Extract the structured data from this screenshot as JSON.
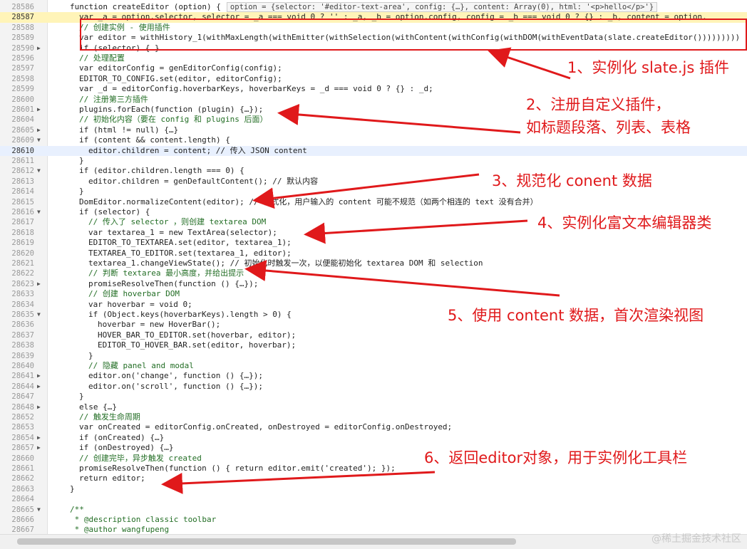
{
  "code_lines": [
    {
      "n": "28586",
      "fold": "",
      "indent": 2,
      "text": "function createEditor (option) {",
      "tip": "option = {selector: '#editor-text-area', config: {…}, content: Array(0), html: '<p>hello</p>'}",
      "cls": ""
    },
    {
      "n": "28587",
      "fold": "",
      "indent": 3,
      "text": "var _a = option.selector, selector = _a === void 0 ? '' : _a, _b = option.config, config = _b === void 0 ? {} : _b, content = option.",
      "tip": "",
      "cls": "hl"
    },
    {
      "n": "28588",
      "fold": "",
      "indent": 3,
      "text": "// 创建实例 - 使用插件",
      "tip": "",
      "cls": "cm"
    },
    {
      "n": "28589",
      "fold": "",
      "indent": 3,
      "text": "var editor = withHistory_1(withMaxLength(withEmitter(withSelection(withContent(withConfig(withDOM(withEventData(slate.createEditor()))))))))",
      "tip": "",
      "cls": ""
    },
    {
      "n": "28590",
      "fold": "▶",
      "indent": 3,
      "text": "if (selector) {…}",
      "tip": "",
      "cls": ""
    },
    {
      "n": "28596",
      "fold": "",
      "indent": 3,
      "text": "// 处理配置",
      "tip": "",
      "cls": "cm"
    },
    {
      "n": "28597",
      "fold": "",
      "indent": 3,
      "text": "var editorConfig = genEditorConfig(config);",
      "tip": "",
      "cls": ""
    },
    {
      "n": "28598",
      "fold": "",
      "indent": 3,
      "text": "EDITOR_TO_CONFIG.set(editor, editorConfig);",
      "tip": "",
      "cls": ""
    },
    {
      "n": "28599",
      "fold": "",
      "indent": 3,
      "text": "var _d = editorConfig.hoverbarKeys, hoverbarKeys = _d === void 0 ? {} : _d;",
      "tip": "",
      "cls": ""
    },
    {
      "n": "28600",
      "fold": "",
      "indent": 3,
      "text": "// 注册第三方插件",
      "tip": "",
      "cls": "cm"
    },
    {
      "n": "28601",
      "fold": "▶",
      "indent": 3,
      "text": "plugins.forEach(function (plugin) {…});",
      "tip": "",
      "cls": ""
    },
    {
      "n": "28604",
      "fold": "",
      "indent": 3,
      "text": "// 初始化内容（要在 config 和 plugins 后面）",
      "tip": "",
      "cls": "cm"
    },
    {
      "n": "28605",
      "fold": "▶",
      "indent": 3,
      "text": "if (html != null) {…}",
      "tip": "",
      "cls": ""
    },
    {
      "n": "28609",
      "fold": "▼",
      "indent": 3,
      "text": "if (content && content.length) {",
      "tip": "",
      "cls": ""
    },
    {
      "n": "28610",
      "fold": "",
      "indent": 4,
      "text": "editor.children = content; // 传入 JSON content",
      "tip": "",
      "cls": "sel"
    },
    {
      "n": "28611",
      "fold": "",
      "indent": 3,
      "text": "}",
      "tip": "",
      "cls": ""
    },
    {
      "n": "28612",
      "fold": "▼",
      "indent": 3,
      "text": "if (editor.children.length === 0) {",
      "tip": "",
      "cls": ""
    },
    {
      "n": "28613",
      "fold": "",
      "indent": 4,
      "text": "editor.children = genDefaultContent(); // 默认内容",
      "tip": "",
      "cls": ""
    },
    {
      "n": "28614",
      "fold": "",
      "indent": 3,
      "text": "}",
      "tip": "",
      "cls": ""
    },
    {
      "n": "28615",
      "fold": "",
      "indent": 3,
      "text": "DomEditor.normalizeContent(editor); // 格式化，用户输入的 content 可能不规范（如两个相连的 text 没有合并）",
      "tip": "",
      "cls": ""
    },
    {
      "n": "28616",
      "fold": "▼",
      "indent": 3,
      "text": "if (selector) {",
      "tip": "",
      "cls": ""
    },
    {
      "n": "28617",
      "fold": "",
      "indent": 4,
      "text": "// 传入了 selector ，则创建 textarea DOM",
      "tip": "",
      "cls": "cm"
    },
    {
      "n": "28618",
      "fold": "",
      "indent": 4,
      "text": "var textarea_1 = new TextArea(selector);",
      "tip": "",
      "cls": ""
    },
    {
      "n": "28619",
      "fold": "",
      "indent": 4,
      "text": "EDITOR_TO_TEXTAREA.set(editor, textarea_1);",
      "tip": "",
      "cls": ""
    },
    {
      "n": "28620",
      "fold": "",
      "indent": 4,
      "text": "TEXTAREA_TO_EDITOR.set(textarea_1, editor);",
      "tip": "",
      "cls": ""
    },
    {
      "n": "28621",
      "fold": "",
      "indent": 4,
      "text": "textarea_1.changeViewState(); // 初始化时触发一次，以便能初始化 textarea DOM 和 selection",
      "tip": "",
      "cls": ""
    },
    {
      "n": "28622",
      "fold": "",
      "indent": 4,
      "text": "// 判断 textarea 最小高度，并给出提示",
      "tip": "",
      "cls": "cm"
    },
    {
      "n": "28623",
      "fold": "▶",
      "indent": 4,
      "text": "promiseResolveThen(function () {…});",
      "tip": "",
      "cls": ""
    },
    {
      "n": "28633",
      "fold": "",
      "indent": 4,
      "text": "// 创建 hoverbar DOM",
      "tip": "",
      "cls": "cm"
    },
    {
      "n": "28634",
      "fold": "",
      "indent": 4,
      "text": "var hoverbar = void 0;",
      "tip": "",
      "cls": ""
    },
    {
      "n": "28635",
      "fold": "▼",
      "indent": 4,
      "text": "if (Object.keys(hoverbarKeys).length > 0) {",
      "tip": "",
      "cls": ""
    },
    {
      "n": "28636",
      "fold": "",
      "indent": 5,
      "text": "hoverbar = new HoverBar();",
      "tip": "",
      "cls": ""
    },
    {
      "n": "28637",
      "fold": "",
      "indent": 5,
      "text": "HOVER_BAR_TO_EDITOR.set(hoverbar, editor);",
      "tip": "",
      "cls": ""
    },
    {
      "n": "28638",
      "fold": "",
      "indent": 5,
      "text": "EDITOR_TO_HOVER_BAR.set(editor, hoverbar);",
      "tip": "",
      "cls": ""
    },
    {
      "n": "28639",
      "fold": "",
      "indent": 4,
      "text": "}",
      "tip": "",
      "cls": ""
    },
    {
      "n": "28640",
      "fold": "",
      "indent": 4,
      "text": "// 隐藏 panel and modal",
      "tip": "",
      "cls": "cm"
    },
    {
      "n": "28641",
      "fold": "▶",
      "indent": 4,
      "text": "editor.on('change', function () {…});",
      "tip": "",
      "cls": ""
    },
    {
      "n": "28644",
      "fold": "▶",
      "indent": 4,
      "text": "editor.on('scroll', function () {…});",
      "tip": "",
      "cls": ""
    },
    {
      "n": "28647",
      "fold": "",
      "indent": 3,
      "text": "}",
      "tip": "",
      "cls": ""
    },
    {
      "n": "28648",
      "fold": "▶",
      "indent": 3,
      "text": "else {…}",
      "tip": "",
      "cls": ""
    },
    {
      "n": "28652",
      "fold": "",
      "indent": 3,
      "text": "// 触发生命周期",
      "tip": "",
      "cls": "cm"
    },
    {
      "n": "28653",
      "fold": "",
      "indent": 3,
      "text": "var onCreated = editorConfig.onCreated, onDestroyed = editorConfig.onDestroyed;",
      "tip": "",
      "cls": ""
    },
    {
      "n": "28654",
      "fold": "▶",
      "indent": 3,
      "text": "if (onCreated) {…}",
      "tip": "",
      "cls": ""
    },
    {
      "n": "28657",
      "fold": "▶",
      "indent": 3,
      "text": "if (onDestroyed) {…}",
      "tip": "",
      "cls": ""
    },
    {
      "n": "28660",
      "fold": "",
      "indent": 3,
      "text": "// 创建完毕，异步触发 created",
      "tip": "",
      "cls": "cm"
    },
    {
      "n": "28661",
      "fold": "",
      "indent": 3,
      "text": "promiseResolveThen(function () { return editor.emit('created'); });",
      "tip": "",
      "cls": ""
    },
    {
      "n": "28662",
      "fold": "",
      "indent": 3,
      "text": "return editor;",
      "tip": "",
      "cls": ""
    },
    {
      "n": "28663",
      "fold": "",
      "indent": 2,
      "text": "}",
      "tip": "",
      "cls": ""
    },
    {
      "n": "28664",
      "fold": "",
      "indent": 0,
      "text": "",
      "tip": "",
      "cls": ""
    },
    {
      "n": "28665",
      "fold": "▼",
      "indent": 2,
      "text": "/**",
      "tip": "",
      "cls": "cm"
    },
    {
      "n": "28666",
      "fold": "",
      "indent": 2,
      "text": " * @description classic toolbar",
      "tip": "",
      "cls": "cm"
    },
    {
      "n": "28667",
      "fold": "",
      "indent": 2,
      "text": " * @author wangfupeng",
      "tip": "",
      "cls": "cm"
    }
  ],
  "annotations": [
    "1、实例化 slate.js 插件",
    "2、注册自定义插件，",
    "如标题段落、列表、表格",
    "3、规范化 conent 数据",
    "4、实例化富文本编辑器类",
    "5、使用 content 数据，首次渲染视图",
    "6、返回editor对象，用于实例化工具栏"
  ],
  "watermark": "@稀土掘金技术社区",
  "colors": {
    "annotation": "#e0191b",
    "highlight": "#fff4b8",
    "selection": "#e8f0fe"
  }
}
